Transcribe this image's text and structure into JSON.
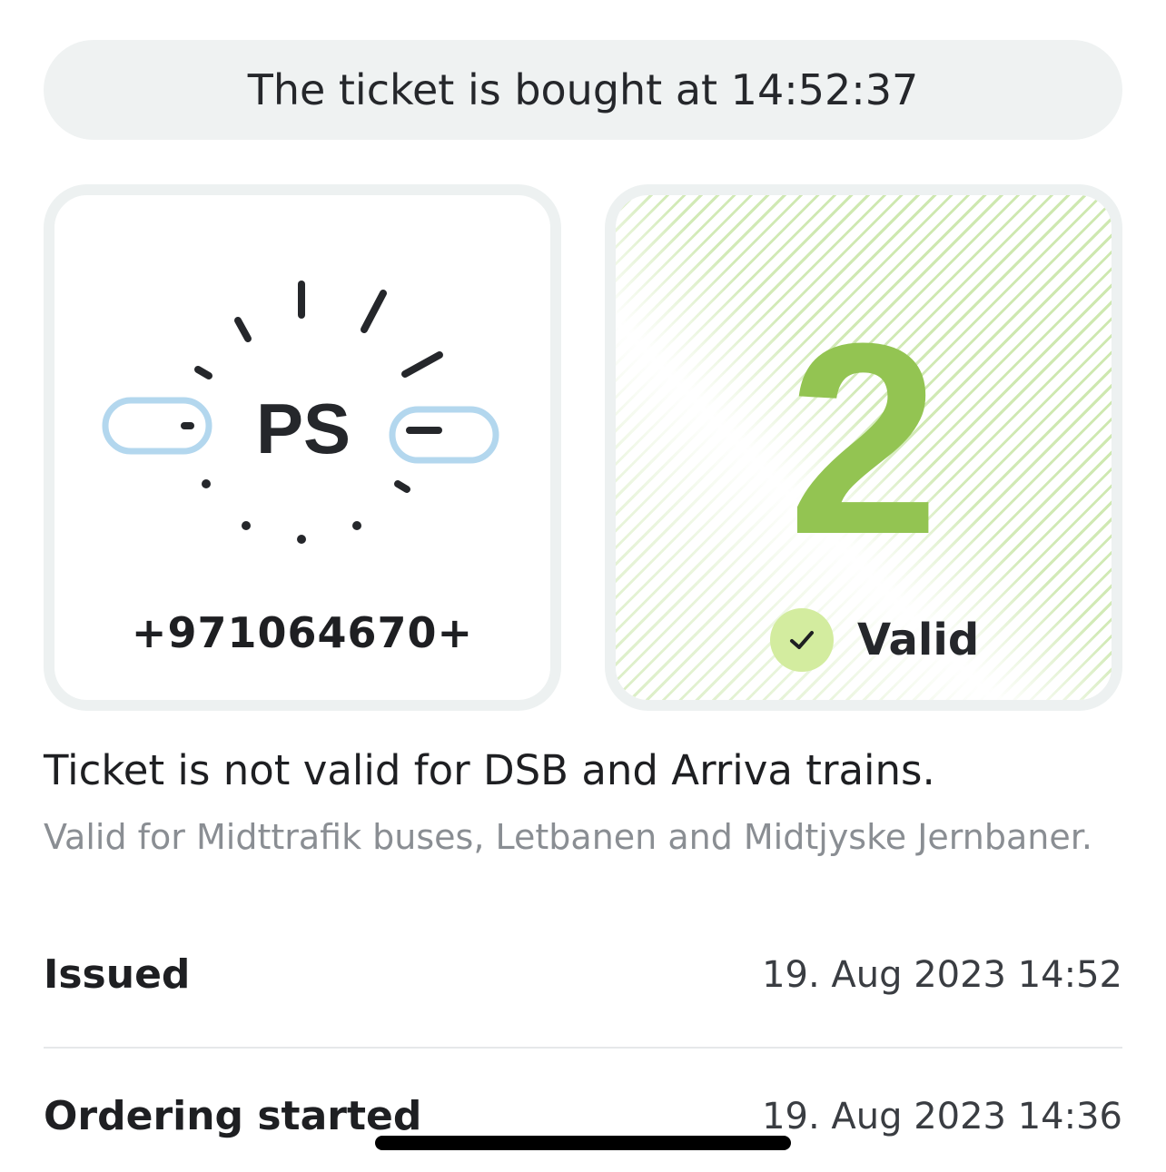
{
  "banner": {
    "text": "The ticket is bought at 14:52:37"
  },
  "ticket_card": {
    "logo_text": "PS",
    "code": "+971064670+"
  },
  "status_card": {
    "zones": "2",
    "status_label": "Valid",
    "status_icon": "check-icon",
    "accent_color": "#93c452"
  },
  "notice": {
    "primary": "Ticket is not valid for DSB and Arriva trains.",
    "secondary": "Valid for Midttrafik buses, Letbanen and Midtjyske Jernbaner."
  },
  "details": [
    {
      "label": "Issued",
      "value": "19. Aug 2023 14:52"
    },
    {
      "label": "Ordering started",
      "value": "19. Aug 2023 14:36"
    }
  ]
}
